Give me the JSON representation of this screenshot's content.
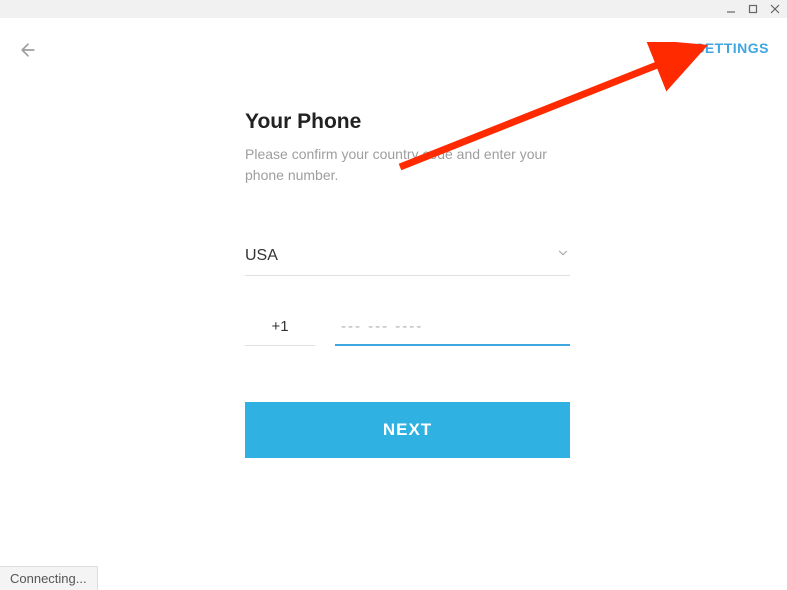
{
  "header": {
    "settings_label": "SETTINGS"
  },
  "content": {
    "title": "Your Phone",
    "subtitle": "Please confirm your country code and enter your phone number."
  },
  "form": {
    "country_name": "USA",
    "country_code": "+1",
    "phone_placeholder": "--- --- ----",
    "next_label": "NEXT"
  },
  "status": {
    "text": "Connecting..."
  }
}
